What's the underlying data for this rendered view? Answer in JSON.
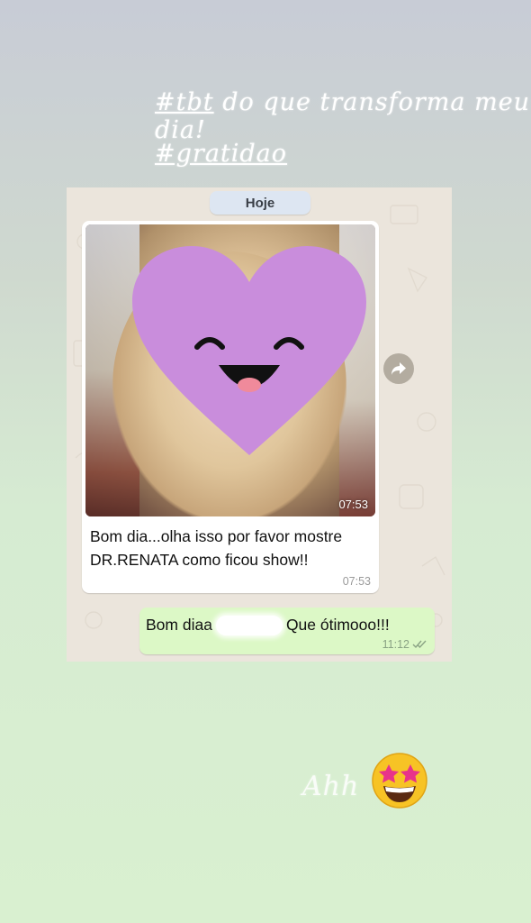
{
  "story": {
    "caption_line1_tag": "#tbt",
    "caption_line1_rest": " do que transforma meu dia!",
    "caption_line2": "#gratidao",
    "footer_text": "Ahh",
    "footer_emoji": "star-struck-emoji"
  },
  "chat": {
    "date_chip": "Hoje",
    "incoming": {
      "photo_time": "07:53",
      "text_line1": "Bom dia...olha isso por favor mostre",
      "text_line2": "DR.RENATA como ficou show!!",
      "time": "07:53",
      "overlay_sticker": "heart-face-sticker",
      "forward_icon": "forward-icon"
    },
    "outgoing": {
      "text_before": "Bom diaa",
      "text_after": "Que ótimooo!!!",
      "time": "11:12",
      "status_icon": "double-check-icon"
    }
  },
  "colors": {
    "incoming_bubble": "#ffffff",
    "outgoing_bubble": "#dcf8c6",
    "chat_wallpaper": "#ebe5dc",
    "heart": "#c98ddc"
  }
}
